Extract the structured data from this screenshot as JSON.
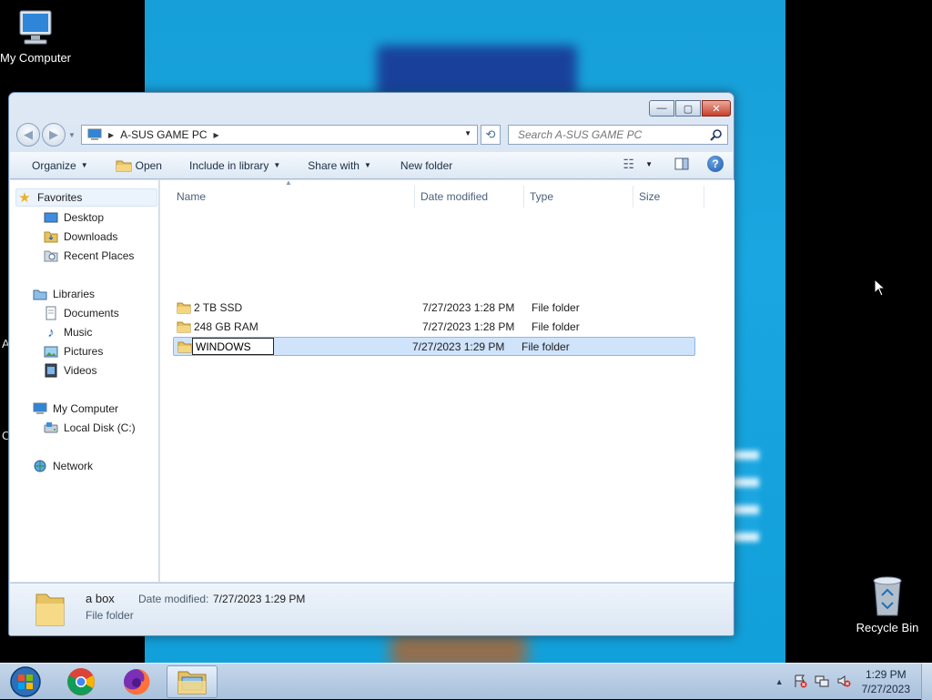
{
  "desktop": {
    "icons": [
      {
        "label": "My Computer"
      },
      {
        "label": "Recycle Bin"
      }
    ],
    "edge_letters": "A\n\n\n\nC"
  },
  "window": {
    "controls": {
      "minimize": "—",
      "maximize": "▢",
      "close": "✕"
    },
    "address": {
      "crumbs": [
        "A-SUS GAME PC"
      ]
    },
    "search": {
      "placeholder": "Search A-SUS GAME PC"
    },
    "toolbar": {
      "organize": "Organize",
      "open": "Open",
      "include_in_library": "Include in library",
      "share_with": "Share with",
      "new_folder": "New folder"
    },
    "nav_pane": {
      "favorites": {
        "label": "Favorites",
        "items": [
          "Desktop",
          "Downloads",
          "Recent Places"
        ]
      },
      "libraries": {
        "label": "Libraries",
        "items": [
          "Documents",
          "Music",
          "Pictures",
          "Videos"
        ]
      },
      "computer": {
        "label": "My Computer",
        "items": [
          "Local Disk (C:)"
        ]
      },
      "network": {
        "label": "Network"
      }
    },
    "columns": {
      "name": "Name",
      "date_modified": "Date modified",
      "type": "Type",
      "size": "Size"
    },
    "files": [
      {
        "name": "2 TB SSD",
        "date": "7/27/2023 1:28 PM",
        "type": "File folder"
      },
      {
        "name": "248 GB RAM",
        "date": "7/27/2023 1:28 PM",
        "type": "File folder"
      },
      {
        "name": "WINDOWS",
        "date": "7/27/2023 1:29 PM",
        "type": "File folder",
        "selected": true,
        "renaming": true
      }
    ],
    "details": {
      "name": "a box",
      "date_label": "Date modified:",
      "date_value": "7/27/2023 1:29 PM",
      "type": "File folder"
    }
  },
  "taskbar": {
    "apps": [
      "start-button",
      "chrome",
      "firefox",
      "windows-explorer"
    ],
    "clock": {
      "time": "1:29 PM",
      "date": "7/27/2023"
    }
  },
  "colors": {
    "wallpaper": "#1aa6e0",
    "selection": "#cfe3fa",
    "taskbar": "#b7cbe2"
  }
}
